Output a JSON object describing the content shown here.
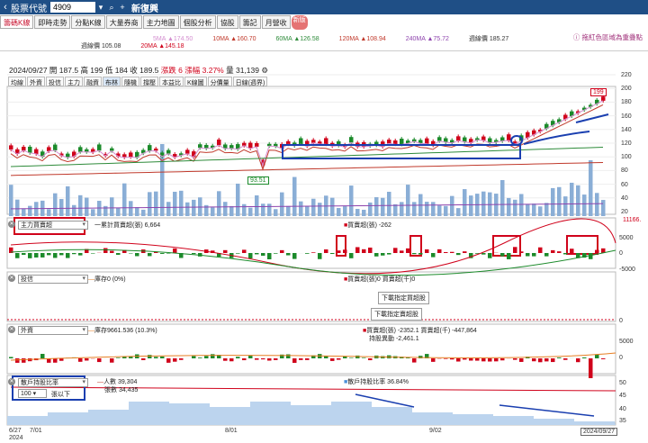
{
  "topbar": {
    "back_icon": "chevron-left",
    "label": "股票代號",
    "code": "4909",
    "name": "新復興"
  },
  "tabs": [
    {
      "label": "籌碼K線",
      "active": true
    },
    {
      "label": "即時走勢"
    },
    {
      "label": "分點K線"
    },
    {
      "label": "大量券商"
    },
    {
      "label": "主力地圖"
    },
    {
      "label": "個股分析"
    },
    {
      "label": "協股"
    },
    {
      "label": "籌記"
    },
    {
      "label": "月營收"
    }
  ],
  "new_badge": "新版",
  "tip": "拖紅色區域為重疊點",
  "ma": {
    "r1": [
      {
        "t": "5MA ▲174.50",
        "c": "#d48fd0"
      },
      {
        "t": "10MA ▲160.70",
        "c": "#c0392b"
      },
      {
        "t": "60MA ▲126.58",
        "c": "#2e8b3a"
      },
      {
        "t": "120MA ▲108.94",
        "c": "#c0392b"
      },
      {
        "t": "240MA ▲75.72",
        "c": "#8e44ad"
      },
      {
        "t": "週線價 185.27",
        "c": "#333"
      }
    ],
    "r2": [
      {
        "t": "週線價 105.08",
        "c": "#333"
      },
      {
        "t": "20MA ▲145.18",
        "c": "#d0021b"
      }
    ]
  },
  "info": {
    "date": "2024/09/27",
    "open": "開 187.5",
    "high": "高 199",
    "low": "低 184",
    "close": "收 189.5",
    "chg": "漲跌 6",
    "pct": "漲幅 3.27%",
    "vol": "量 31,139"
  },
  "toolbar": [
    "均線",
    "外資",
    "投信",
    "主力",
    "融資",
    "布林",
    "隨機",
    "撐壓",
    "本益比",
    "K線圖",
    "分價量"
  ],
  "toolbar_sel": "日線(週界)",
  "price_axis": [
    "220",
    "200",
    "180",
    "160",
    "140",
    "120",
    "100",
    "80",
    "60",
    "40",
    "20"
  ],
  "price_labels": {
    "high": "199",
    "low": "93.51"
  },
  "panel1": {
    "dd": "主力買賣超",
    "a": "一累計買賣超(張) 6,664",
    "b": "買賣超(張) -262",
    "right_top": "11166.",
    "axis": [
      "5000",
      "0",
      "-5000"
    ]
  },
  "panel2": {
    "dd": "投信",
    "a": "庫存0 (0%)",
    "b": "買賣超(張)0 買賣超(千)0",
    "btn1": "下載指定買超股",
    "btn2": "下載指定賣超股",
    "axis": [
      "0"
    ]
  },
  "panel3": {
    "dd": "外資",
    "a": "庫存9661.536 (10.3%)",
    "b": "買賣超(張) -2352.1 買賣超(千) -447,864",
    "c": "持股異動 -2,461.1",
    "axis": [
      "5000",
      "0"
    ]
  },
  "panel4": {
    "dd": "散戶持股比率",
    "a": "人數 39,304",
    "a2": "張數 34,435",
    "b": "散戶持股比率 36.84%",
    "sel": "100",
    "sel2": "張以下",
    "axis": [
      "50",
      "45",
      "40",
      "35"
    ]
  },
  "xaxis": [
    "6/27",
    "7/01",
    "8/01",
    "9/02"
  ],
  "xaxis_year": "2024",
  "xaxis_end": "2024/09/27"
}
